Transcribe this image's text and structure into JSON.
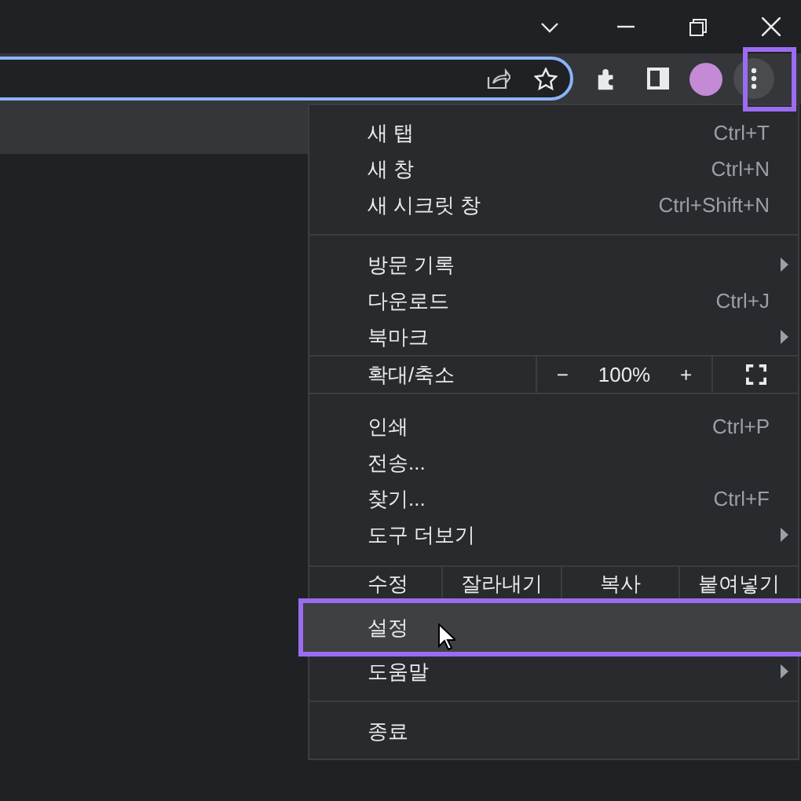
{
  "toolbar": {
    "more_button_outlined": true
  },
  "menu": {
    "items": [
      {
        "kind": "item",
        "label": "새 탭",
        "shortcut": "Ctrl+T",
        "submenu": false,
        "hovered": false,
        "outlined": false
      },
      {
        "kind": "item",
        "label": "새 창",
        "shortcut": "Ctrl+N",
        "submenu": false,
        "hovered": false,
        "outlined": false
      },
      {
        "kind": "item",
        "label": "새 시크릿 창",
        "shortcut": "Ctrl+Shift+N",
        "submenu": false,
        "hovered": false,
        "outlined": false
      },
      {
        "kind": "divider"
      },
      {
        "kind": "item",
        "label": "방문 기록",
        "submenu": true,
        "hovered": false,
        "outlined": false
      },
      {
        "kind": "item",
        "label": "다운로드",
        "shortcut": "Ctrl+J",
        "submenu": false,
        "hovered": false,
        "outlined": false
      },
      {
        "kind": "item",
        "label": "북마크",
        "submenu": true,
        "hovered": false,
        "outlined": false
      },
      {
        "kind": "zoom",
        "label": "확대/축소",
        "minus": "−",
        "value": "100%",
        "plus": "+"
      },
      {
        "kind": "item",
        "label": "인쇄",
        "shortcut": "Ctrl+P",
        "submenu": false,
        "hovered": false,
        "outlined": false
      },
      {
        "kind": "item",
        "label": "전송...",
        "submenu": false,
        "hovered": false,
        "outlined": false
      },
      {
        "kind": "item",
        "label": "찾기...",
        "shortcut": "Ctrl+F",
        "submenu": false,
        "hovered": false,
        "outlined": false
      },
      {
        "kind": "item",
        "label": "도구 더보기",
        "submenu": true,
        "hovered": false,
        "outlined": false
      },
      {
        "kind": "edit",
        "label": "수정",
        "buttons": [
          "잘라내기",
          "복사",
          "붙여넣기"
        ]
      },
      {
        "kind": "item",
        "label": "설정",
        "submenu": false,
        "hovered": true,
        "outlined": true
      },
      {
        "kind": "item",
        "label": "도움말",
        "submenu": true,
        "hovered": false,
        "outlined": false
      },
      {
        "kind": "divider"
      },
      {
        "kind": "item",
        "label": "종료",
        "submenu": false,
        "hovered": false,
        "outlined": false
      }
    ]
  }
}
